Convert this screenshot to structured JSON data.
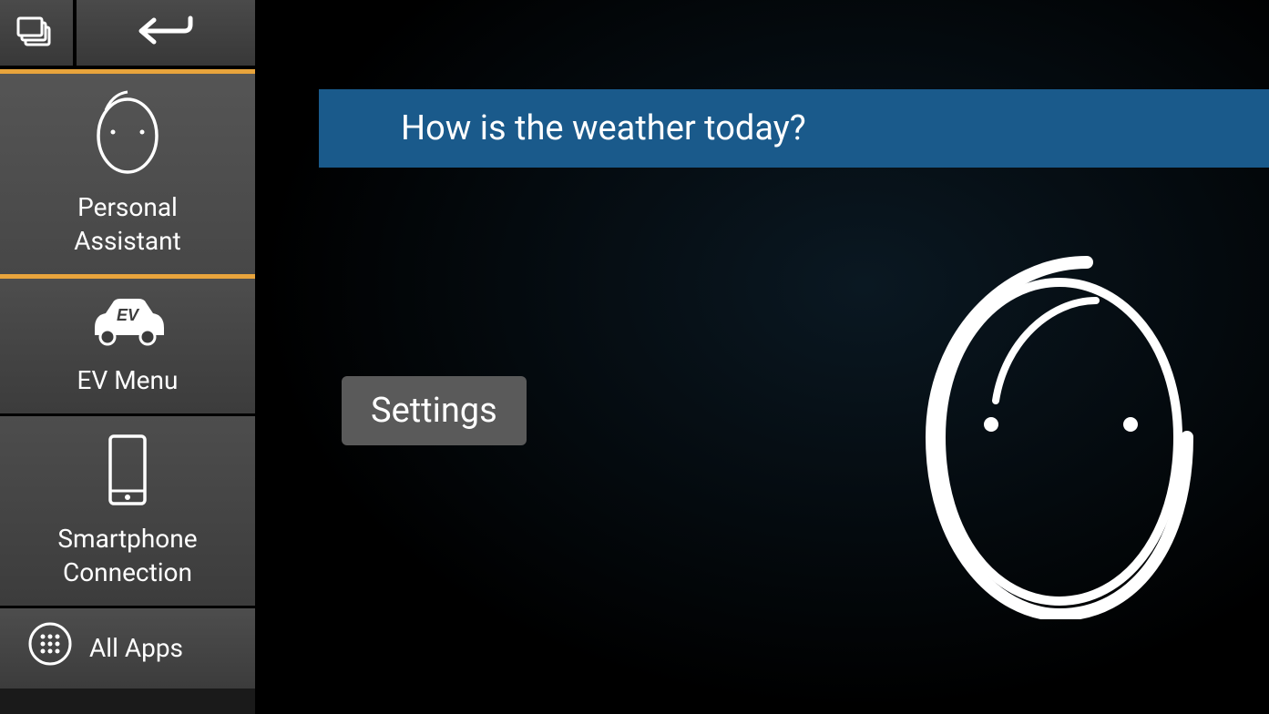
{
  "topbar": {
    "home_icon": "layers-icon",
    "back_icon": "back-arrow-icon"
  },
  "sidebar": {
    "items": [
      {
        "icon": "assistant-face-icon",
        "label": "Personal\nAssistant",
        "selected": true
      },
      {
        "icon": "ev-car-icon",
        "label": "EV Menu",
        "selected": false
      },
      {
        "icon": "smartphone-icon",
        "label": "Smartphone\nConnection",
        "selected": false
      },
      {
        "icon": "apps-grid-icon",
        "label": "All Apps",
        "selected": false
      }
    ]
  },
  "main": {
    "prompt_text": "How is the weather today?",
    "settings_label": "Settings"
  },
  "colors": {
    "accent": "#e8a43c",
    "prompt_bg": "#1a5a8b"
  }
}
